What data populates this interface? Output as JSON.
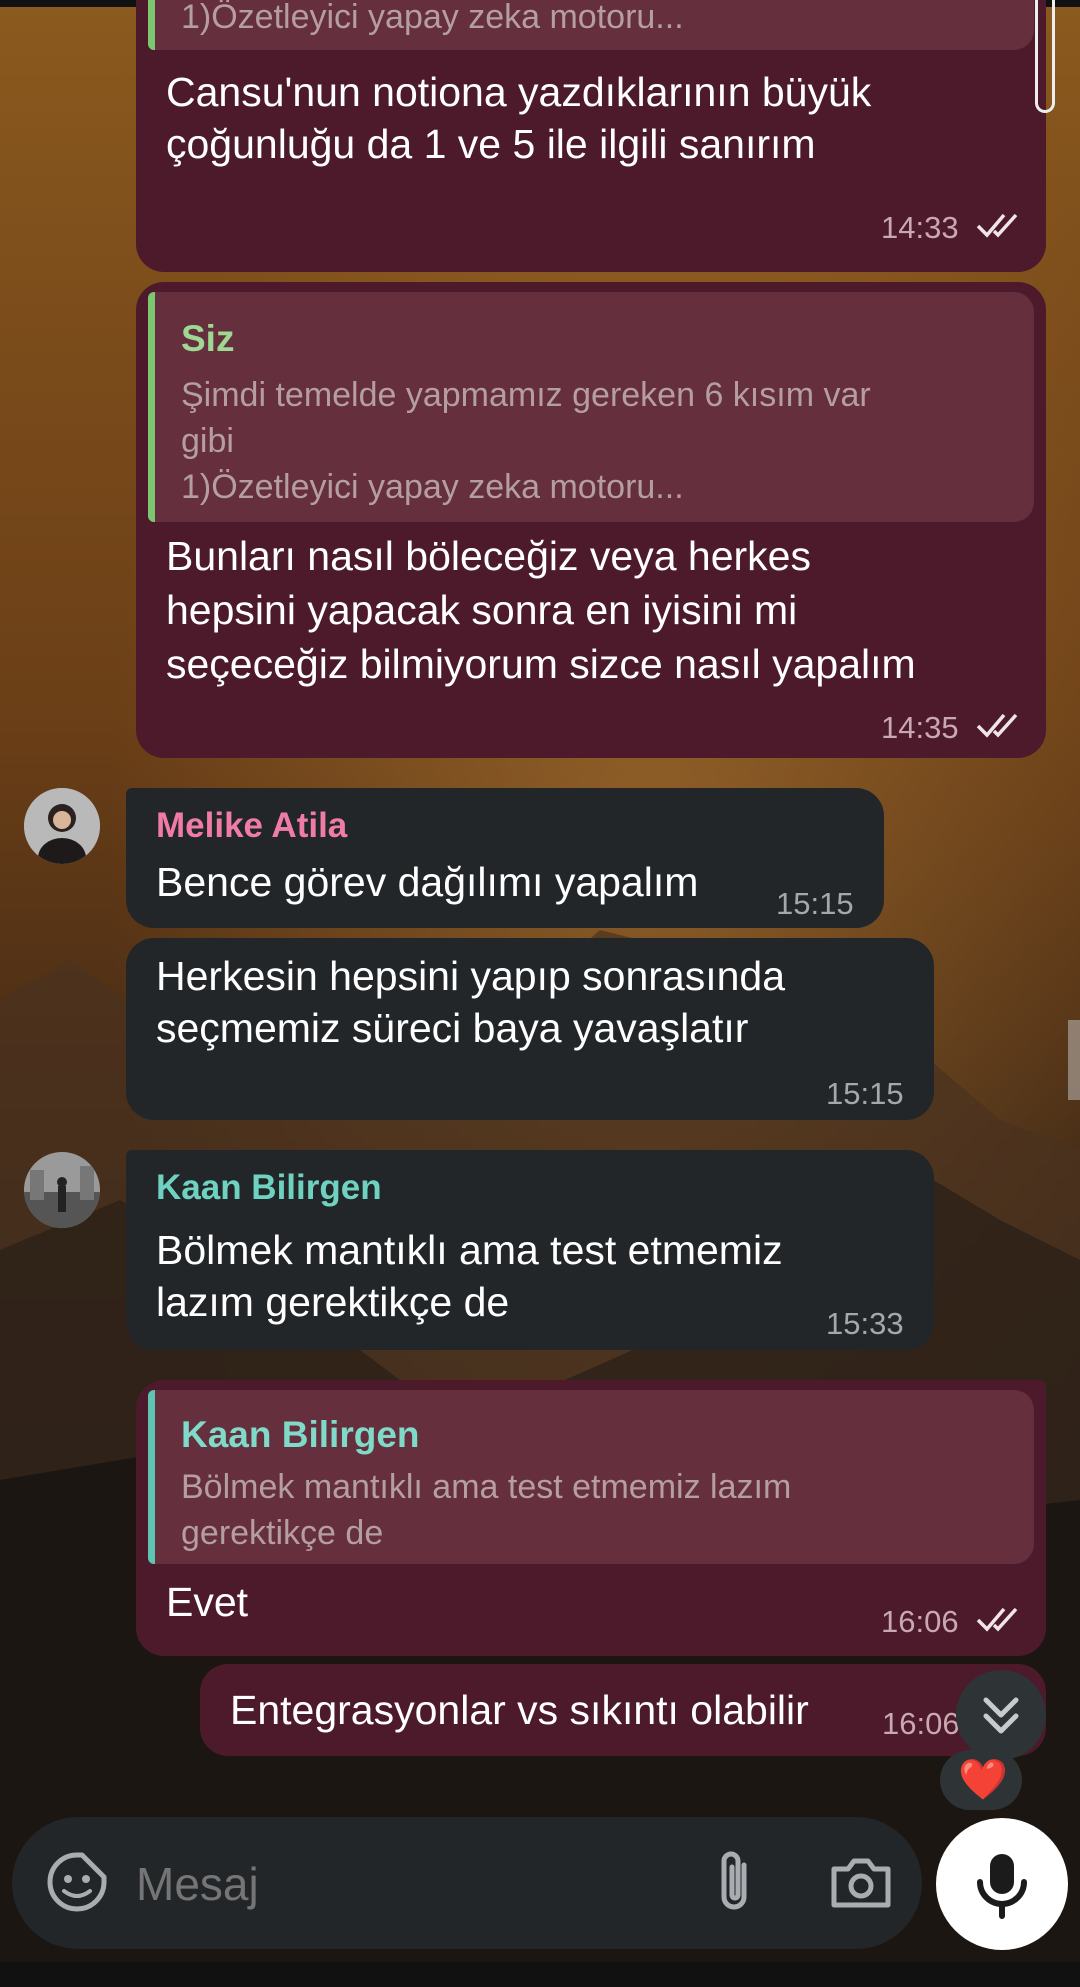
{
  "messages": [
    {
      "quote_tail": "1)Özetleyici yapay zeka motoru...",
      "lines": [
        "Cansu'nun notiona yazdıklarının büyük",
        "çoğunluğu da 1 ve 5 ile ilgili sanırım"
      ],
      "time": "14:33"
    },
    {
      "quote_name": "Siz",
      "quote_lines": [
        "Şimdi temelde yapmamız gereken 6 kısım var",
        "gibi",
        "1)Özetleyici yapay zeka motoru..."
      ],
      "lines": [
        "Bunları nasıl böleceğiz veya herkes",
        "hepsini yapacak sonra en iyisini mi",
        "seçeceğiz bilmiyorum sizce nasıl yapalım"
      ],
      "time": "14:35"
    },
    {
      "sender": "Melike Atila",
      "sender_color": "#f07ca6",
      "lines": [
        "Bence görev dağılımı yapalım"
      ],
      "time": "15:15"
    },
    {
      "lines": [
        "Herkesin hepsini yapıp sonrasında",
        "seçmemiz süreci baya yavaşlatır"
      ],
      "time": "15:15"
    },
    {
      "sender": "Kaan Bilirgen",
      "sender_color": "#6fd1c0",
      "lines": [
        "Bölmek mantıklı ama test etmemiz",
        "lazım gerektikçe de"
      ],
      "time": "15:33"
    },
    {
      "quote_name": "Kaan Bilirgen",
      "quote_lines": [
        "Bölmek mantıklı ama test etmemiz lazım",
        "gerektikçe de"
      ],
      "lines": [
        "Evet"
      ],
      "time": "16:06"
    },
    {
      "lines": [
        "Entegrasyonlar vs sıkıntı olabilir"
      ],
      "time": "16:06"
    }
  ],
  "reaction": "❤️",
  "composer": {
    "placeholder": "Mesaj"
  },
  "icons": [
    "sticker-icon",
    "attach-icon",
    "camera-icon",
    "mic-icon",
    "scroll-down-icon",
    "double-check-icon"
  ],
  "colors": {
    "outgoing_bubble": "#4c1a2a",
    "incoming_bubble": "#222629",
    "quote_accent_green": "#7cc770",
    "quote_accent_teal": "#5ec4b4"
  }
}
